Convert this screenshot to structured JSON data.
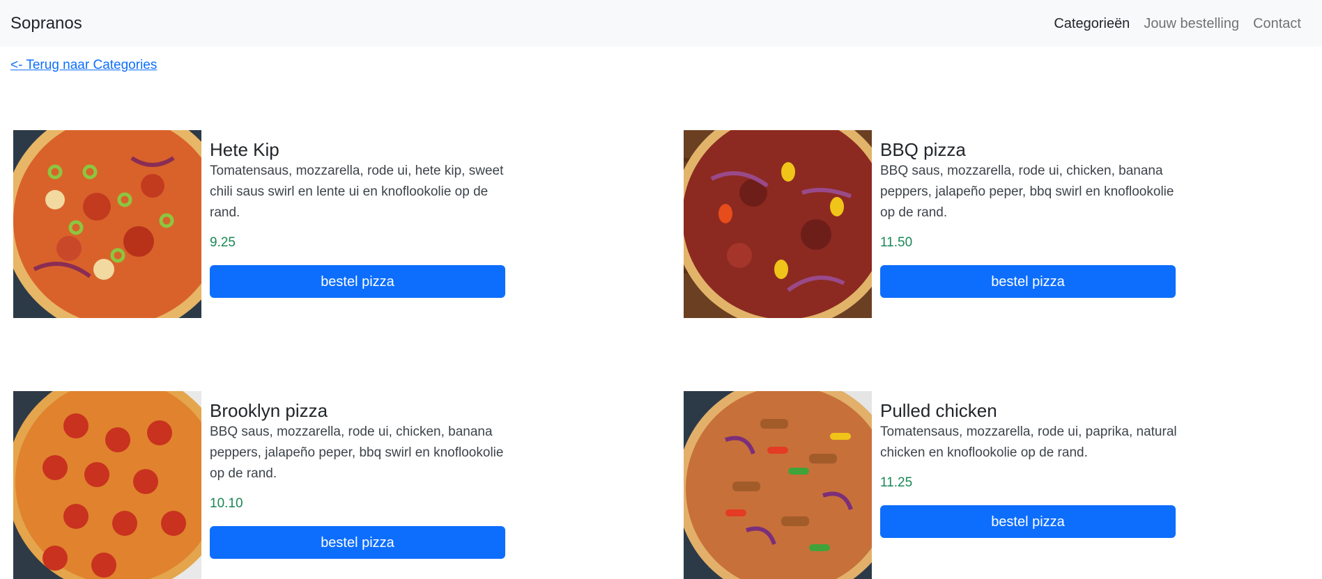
{
  "navbar": {
    "brand": "Sopranos",
    "links": [
      {
        "label": "Categorieën",
        "active": true
      },
      {
        "label": "Jouw bestelling",
        "active": false
      },
      {
        "label": "Contact",
        "active": false
      }
    ]
  },
  "back_link": "<- Terug naar Categories",
  "products": [
    {
      "name": "Hete Kip",
      "description": "Tomatensaus, mozzarella, rode ui, hete kip, sweet chili saus swirl en lente ui en knoflookolie op de rand.",
      "price": "9.25",
      "button": "bestel pizza",
      "image_icon": "pizza-image"
    },
    {
      "name": "BBQ pizza",
      "description": "BBQ saus, mozzarella, rode ui, chicken, banana peppers, jalapeño peper, bbq swirl en knoflookolie op de rand.",
      "price": "11.50",
      "button": "bestel pizza",
      "image_icon": "pizza-image"
    },
    {
      "name": "Brooklyn pizza",
      "description": "BBQ saus, mozzarella, rode ui, chicken, banana peppers, jalapeño peper, bbq swirl en knoflookolie op de rand.",
      "price": "10.10",
      "button": "bestel pizza",
      "image_icon": "pizza-image"
    },
    {
      "name": "Pulled chicken",
      "description": "Tomatensaus, mozzarella, rode ui, paprika, natural chicken en knoflookolie op de rand.",
      "price": "11.25",
      "button": "bestel pizza",
      "image_icon": "pizza-image"
    }
  ],
  "colors": {
    "accent": "#0d6efd",
    "price": "#198754",
    "navbar_bg": "#f8f9fa"
  }
}
